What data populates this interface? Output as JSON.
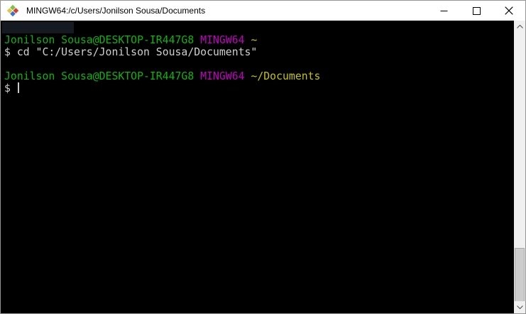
{
  "window": {
    "title": "MINGW64:/c/Users/Jonilson Sousa/Documents",
    "app_icon": "mintty-git-bash-icon",
    "controls": {
      "minimize": "minimize",
      "maximize": "maximize",
      "close": "close"
    }
  },
  "terminal": {
    "palette": {
      "bg": "#000000",
      "fg": "#cfcfcf",
      "green": "#0cb40c",
      "magenta": "#c000c0",
      "yellow": "#c4c400"
    },
    "lines": [
      {
        "segments": []
      },
      {
        "segments": [
          {
            "text": "Jonilson Sousa@DESKTOP-IR447G8",
            "color": "green"
          },
          {
            "text": " ",
            "color": "fg"
          },
          {
            "text": "MINGW64",
            "color": "magenta"
          },
          {
            "text": " ~",
            "color": "yellow"
          }
        ]
      },
      {
        "segments": [
          {
            "text": "$ cd \"C:/Users/Jonilson Sousa/Documents\"",
            "color": "fg"
          }
        ]
      },
      {
        "segments": []
      },
      {
        "segments": [
          {
            "text": "Jonilson Sousa@DESKTOP-IR447G8",
            "color": "green"
          },
          {
            "text": " ",
            "color": "fg"
          },
          {
            "text": "MINGW64",
            "color": "magenta"
          },
          {
            "text": " ~/Documents",
            "color": "yellow"
          }
        ]
      },
      {
        "segments": [
          {
            "text": "$ ",
            "color": "fg"
          }
        ],
        "cursor": true
      }
    ]
  },
  "scrollbar": {
    "up_icon": "chevron-up-icon",
    "down_icon": "chevron-down-icon"
  }
}
